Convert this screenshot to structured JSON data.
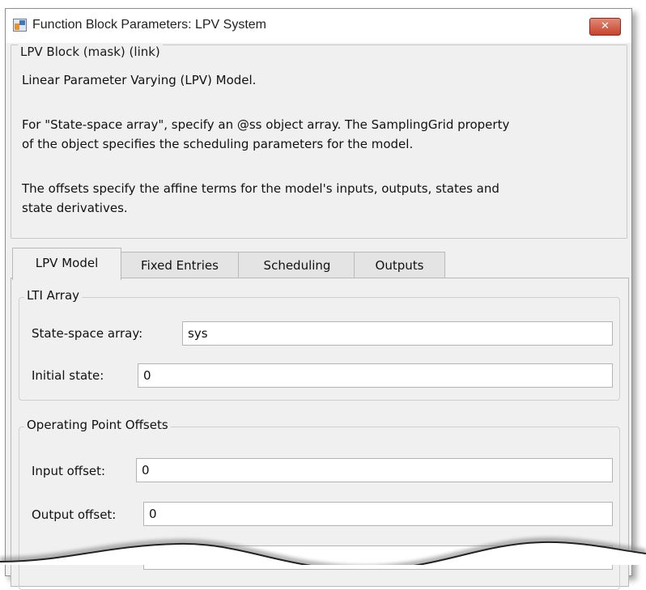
{
  "window": {
    "title": "Function Block Parameters: LPV System",
    "close_symbol": "✕"
  },
  "description": {
    "legend": "LPV Block (mask) (link)",
    "p1": "Linear Parameter Varying (LPV) Model.",
    "p2_line1": "For \"State-space array\", specify an @ss object array. The SamplingGrid property",
    "p2_line2": "of the object specifies the scheduling parameters for the model.",
    "p3_line1": "The offsets specify the affine terms for the model's inputs, outputs, states and",
    "p3_line2": "state derivatives."
  },
  "tabs": [
    {
      "label": "LPV Model",
      "active": true
    },
    {
      "label": "Fixed Entries",
      "active": false
    },
    {
      "label": "Scheduling",
      "active": false
    },
    {
      "label": "Outputs",
      "active": false
    }
  ],
  "lti_array": {
    "legend": "LTI Array",
    "state_space_label": "State-space array:",
    "state_space_value": "sys",
    "initial_state_label": "Initial state:",
    "initial_state_value": "0"
  },
  "offsets": {
    "legend": "Operating Point Offsets",
    "input_label": "Input offset:",
    "input_value": "0",
    "output_label": "Output offset:",
    "output_value": "0"
  },
  "icons": {
    "app": "simulink-block-icon",
    "close": "close-icon"
  },
  "colors": {
    "window_bg": "#f0f0f0",
    "close_button": "#c7432b"
  }
}
